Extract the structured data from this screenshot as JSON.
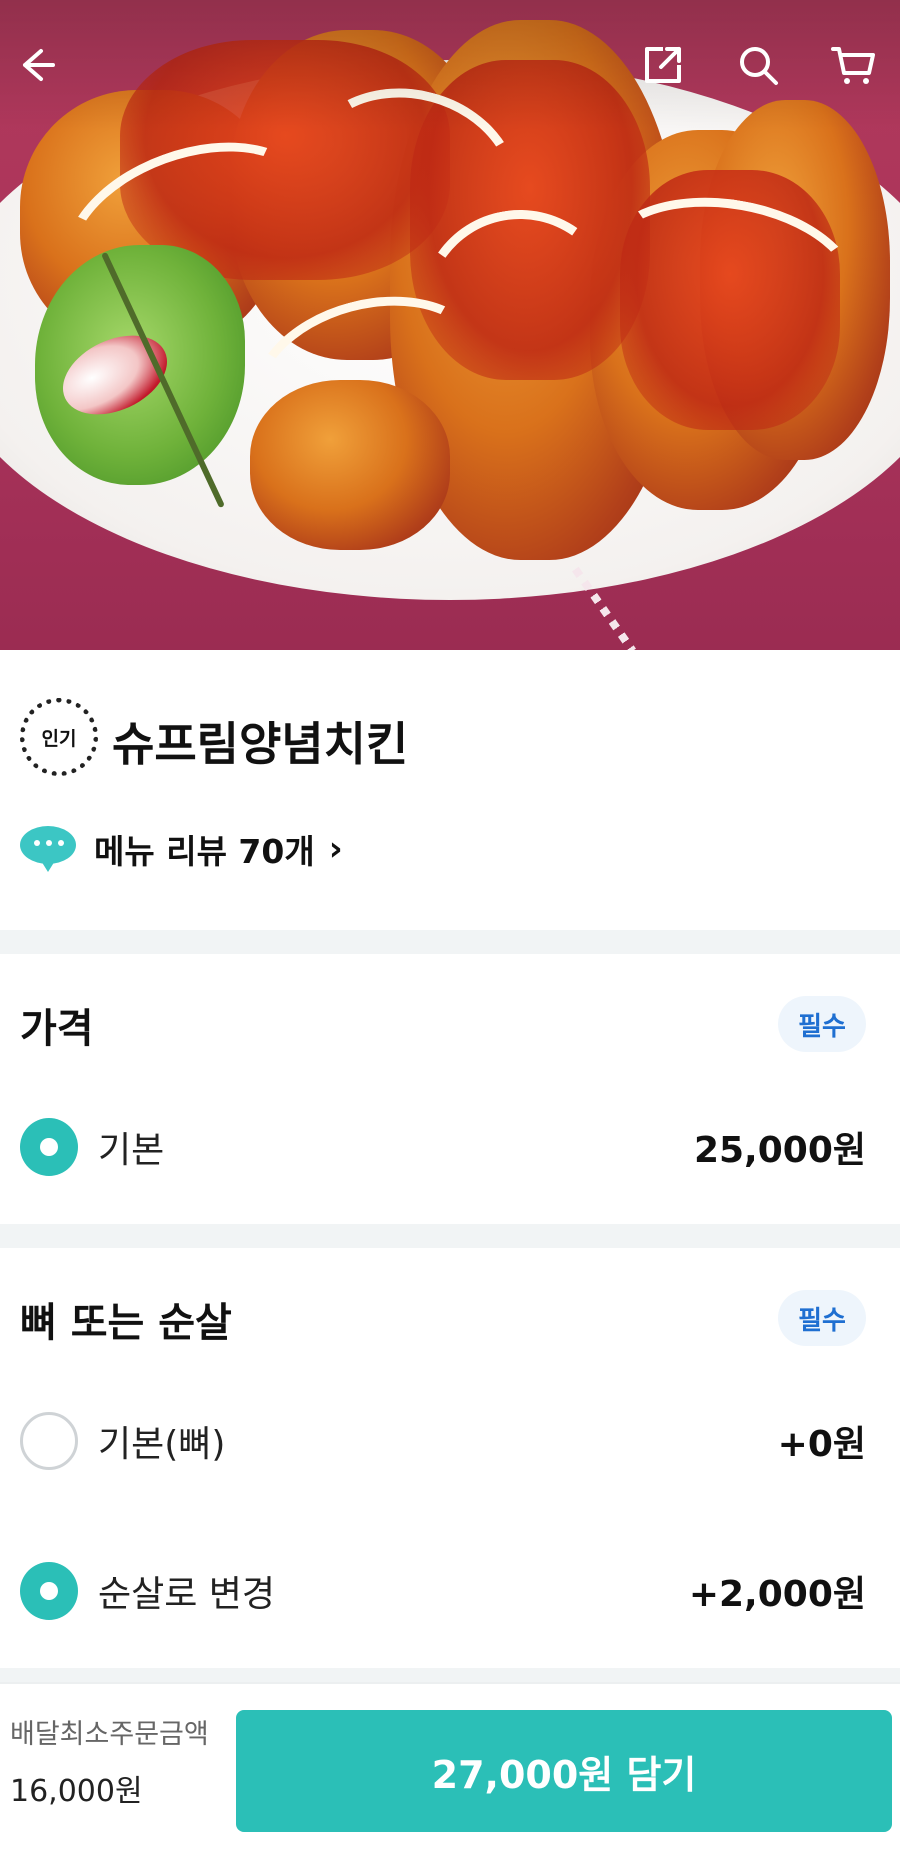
{
  "header": {
    "back_icon": "back-arrow-icon",
    "share_icon": "share-icon",
    "search_icon": "search-icon",
    "cart_icon": "cart-icon"
  },
  "menu": {
    "badge": "인기",
    "title": "슈프림양념치킨",
    "review_link": "메뉴 리뷰 70개",
    "review_chevron": "›"
  },
  "price_section": {
    "title": "가격",
    "required": "필수",
    "options": [
      {
        "label": "기본",
        "price": "25,000원",
        "selected": true
      }
    ]
  },
  "bone_section": {
    "title": "뼈 또는 순살",
    "required": "필수",
    "options": [
      {
        "label": "기본(뼈)",
        "price": "+0원",
        "selected": false
      },
      {
        "label": "순살로 변경",
        "price": "+2,000원",
        "selected": true
      }
    ]
  },
  "bottom_bar": {
    "min_order_label": "배달최소주문금액",
    "min_order_value": "16,000원",
    "add_button": "27,000원 담기"
  },
  "colors": {
    "accent": "#2bbfb7",
    "required_text": "#1f6fd1",
    "required_bg": "#eef5fc",
    "divider": "#f1f4f5"
  }
}
